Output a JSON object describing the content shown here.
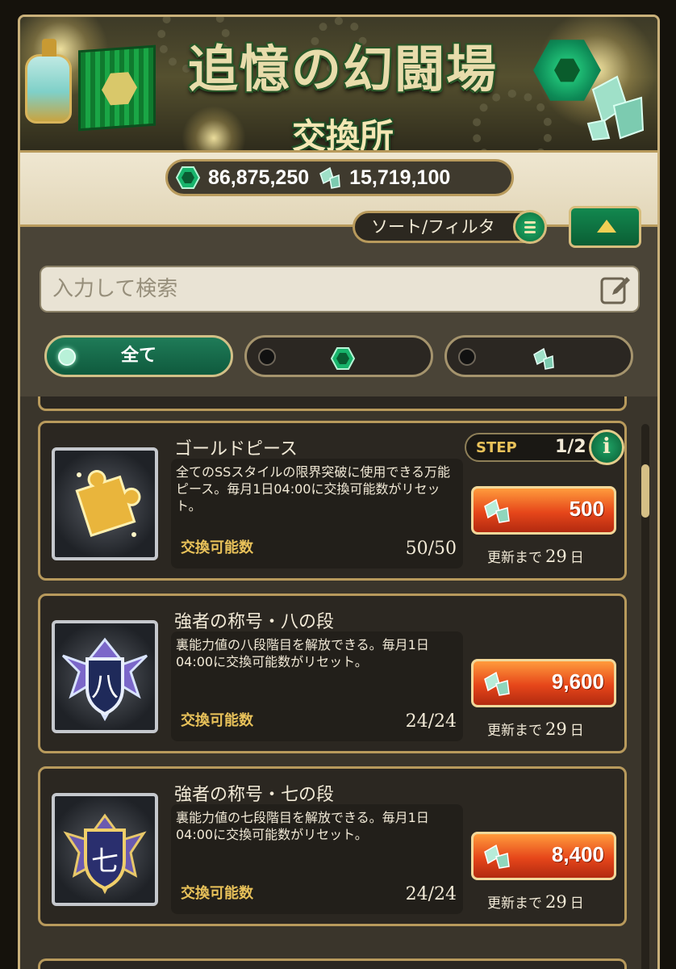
{
  "banner": {
    "title": "追憶の幻闘場",
    "subtitle": "交換所"
  },
  "currency": {
    "medal_icon": "green-medal-icon",
    "medal_amount": "86,875,250",
    "shard_icon": "crystal-shard-icon",
    "shard_amount": "15,719,100"
  },
  "toolbar": {
    "sort_filter_label": "ソート/フィルタ",
    "sort_menu_icon": "menu-lines-icon",
    "collapse_icon": "triangle-up-icon"
  },
  "search": {
    "placeholder": "入力して検索",
    "edit_icon": "pencil-edit-icon"
  },
  "filters": [
    {
      "label": "全て",
      "selected": true
    },
    {
      "label": "",
      "icon": "green-medal-icon",
      "selected": false
    },
    {
      "label": "",
      "icon": "crystal-shard-icon",
      "selected": false
    }
  ],
  "items": [
    {
      "title": "ゴールドピース",
      "description": "全てのSSスタイルの限界突破に使用できる万能ピース。毎月1日04:00に交換可能数がリセット。",
      "stock_label": "交換可能数",
      "stock": "50/50",
      "price": "500",
      "refresh_prefix": "更新まで",
      "refresh_days": "29",
      "refresh_unit": "日",
      "step_label": "STEP",
      "step": "1/2",
      "info_label": "i",
      "icon": "gold-piece-icon"
    },
    {
      "title": "強者の称号・八の段",
      "description": "裏能力値の八段階目を解放できる。毎月1日04:00に交換可能数がリセット。",
      "stock_label": "交換可能数",
      "stock": "24/24",
      "price": "9,600",
      "refresh_prefix": "更新まで",
      "refresh_days": "29",
      "refresh_unit": "日",
      "emblem_char": "八",
      "icon": "emblem-eight-icon"
    },
    {
      "title": "強者の称号・七の段",
      "description": "裏能力値の七段階目を解放できる。毎月1日04:00に交換可能数がリセット。",
      "stock_label": "交換可能数",
      "stock": "24/24",
      "price": "8,400",
      "refresh_prefix": "更新まで",
      "refresh_days": "29",
      "refresh_unit": "日",
      "emblem_char": "七",
      "icon": "emblem-seven-icon"
    }
  ],
  "colors": {
    "accent_green": "#0f6b42",
    "price_orange": "#e6461a",
    "gold_border": "#b89a5c"
  }
}
